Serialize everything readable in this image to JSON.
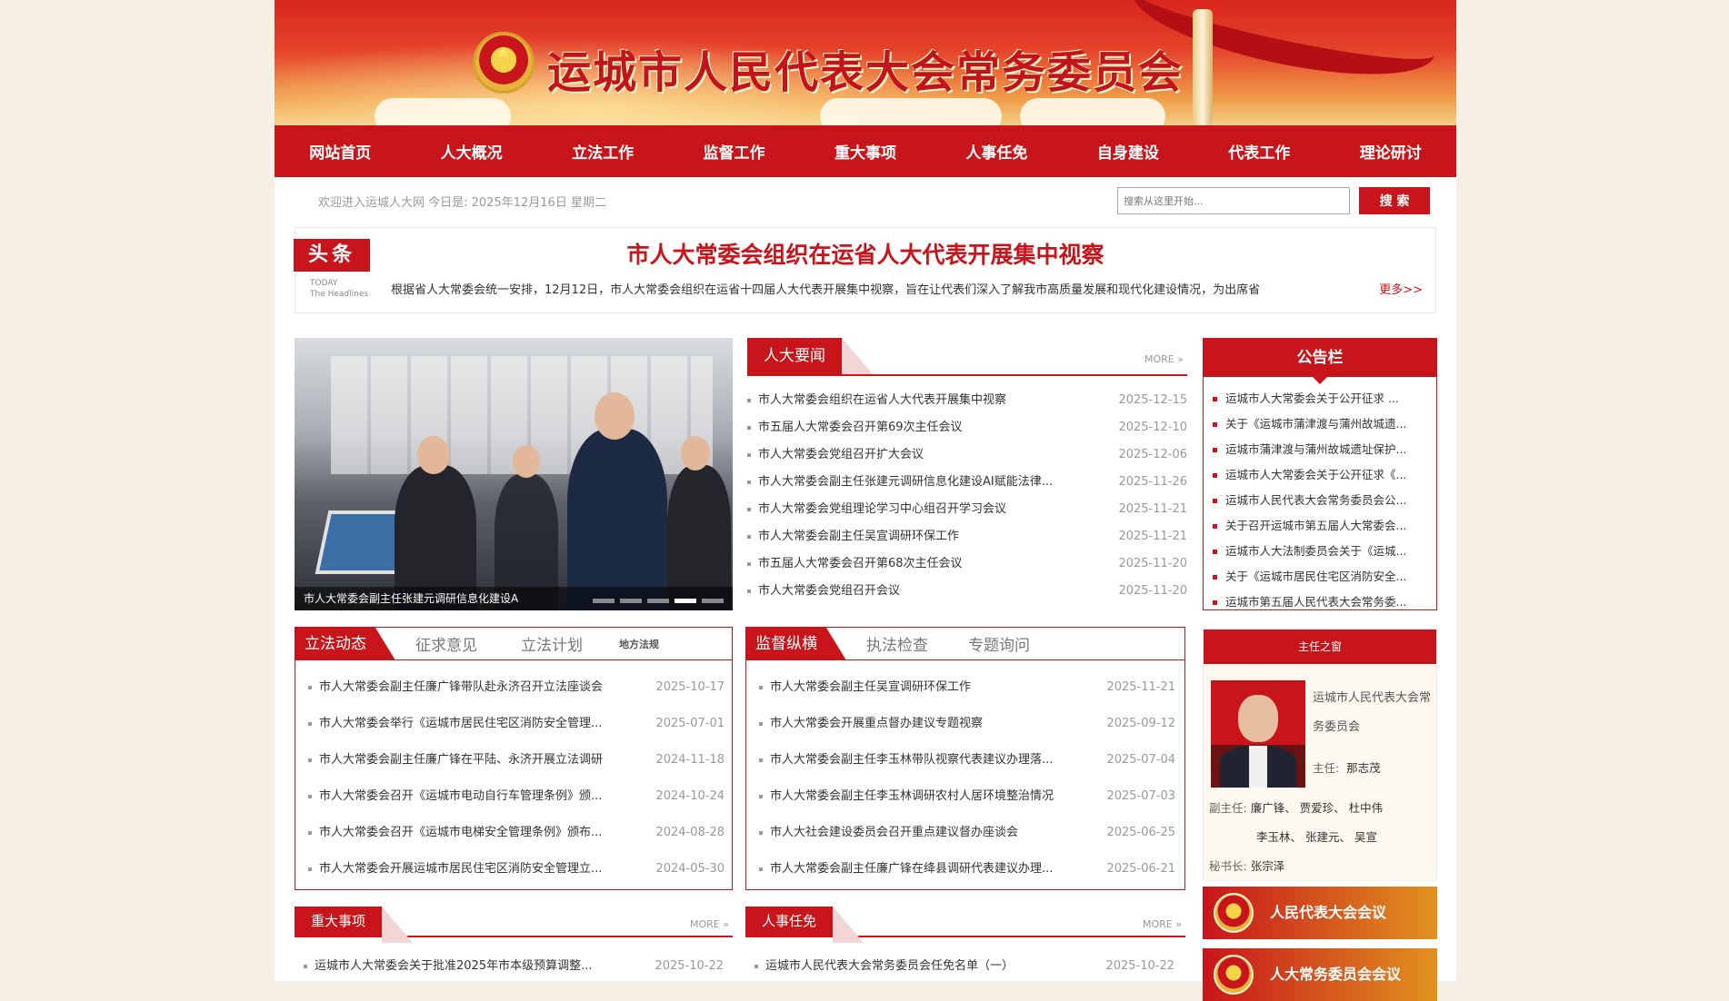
{
  "header": {
    "site_title": "运城市人民代表大会常务委员会"
  },
  "nav": [
    "网站首页",
    "人大概况",
    "立法工作",
    "监督工作",
    "重大事项",
    "人事任免",
    "自身建设",
    "代表工作",
    "理论研讨"
  ],
  "welcome_text": "欢迎进入运城人大网 今日是: 2025年12月16日 星期二",
  "search": {
    "placeholder": "搜索从这里开始...",
    "button": "搜 索"
  },
  "headline": {
    "badge": "头条",
    "sub1": "TODAY",
    "sub2": "The Headlines",
    "title": "市人大常委会组织在运省人大代表开展集中视察",
    "summary": "根据省人大常委会统一安排，12月12日，市人大常委会组织在运省十四届人大代表开展集中视察，旨在让代表们深入了解我市高质量发展和现代化建设情况，为出席省",
    "more": "更多>>"
  },
  "slideshow": {
    "caption": "市人大常委会副主任张建元调研信息化建设A"
  },
  "news": {
    "title": "人大要闻",
    "more": "MORE",
    "items": [
      {
        "title": "市人大常委会组织在运省人大代表开展集中视察",
        "date": "2025-12-15"
      },
      {
        "title": "市五届人大常委会召开第69次主任会议",
        "date": "2025-12-10"
      },
      {
        "title": "市人大常委会党组召开扩大会议",
        "date": "2025-12-06"
      },
      {
        "title": "市人大常委会副主任张建元调研信息化建设AI赋能法律...",
        "date": "2025-11-26"
      },
      {
        "title": "市人大常委会党组理论学习中心组召开学习会议",
        "date": "2025-11-21"
      },
      {
        "title": "市人大常委会副主任吴宣调研环保工作",
        "date": "2025-11-21"
      },
      {
        "title": "市五届人大常委会召开第68次主任会议",
        "date": "2025-11-20"
      },
      {
        "title": "市人大常委会党组召开会议",
        "date": "2025-11-20"
      }
    ]
  },
  "legislation": {
    "tabs": [
      "立法动态",
      "征求意见",
      "立法计划",
      "地方法规"
    ],
    "items": [
      {
        "title": "市人大常委会副主任廉广锋带队赴永济召开立法座谈会",
        "date": "2025-10-17"
      },
      {
        "title": "市人大常委会举行《运城市居民住宅区消防安全管理...",
        "date": "2025-07-01"
      },
      {
        "title": "市人大常委会副主任廉广锋在平陆、永济开展立法调研",
        "date": "2024-11-18"
      },
      {
        "title": "市人大常委会召开《运城市电动自行车管理条例》颁...",
        "date": "2024-10-24"
      },
      {
        "title": "市人大常委会召开《运城市电梯安全管理条例》颁布...",
        "date": "2024-08-28"
      },
      {
        "title": "市人大常委会开展运城市居民住宅区消防安全管理立...",
        "date": "2024-05-30"
      }
    ]
  },
  "supervision": {
    "tabs": [
      "监督纵横",
      "执法检查",
      "专题询问"
    ],
    "items": [
      {
        "title": "市人大常委会副主任吴宣调研环保工作",
        "date": "2025-11-21"
      },
      {
        "title": "市人大常委会开展重点督办建议专题视察",
        "date": "2025-09-12"
      },
      {
        "title": "市人大常委会副主任李玉林带队视察代表建议办理落...",
        "date": "2025-07-04"
      },
      {
        "title": "市人大常委会副主任李玉林调研农村人居环境整治情况",
        "date": "2025-07-03"
      },
      {
        "title": "市人大社会建设委员会召开重点建议督办座谈会",
        "date": "2025-06-25"
      },
      {
        "title": "市人大常委会副主任廉广锋在绛县调研代表建议办理...",
        "date": "2025-06-21"
      }
    ]
  },
  "major": {
    "title": "重大事项",
    "more": "MORE",
    "items": [
      {
        "title": "运城市人大常委会关于批准2025年市本级预算调整...",
        "date": "2025-10-22"
      }
    ]
  },
  "personnel": {
    "title": "人事任免",
    "more": "MORE",
    "items": [
      {
        "title": "运城市人民代表大会常务委员会任免名单（一）",
        "date": "2025-10-22"
      }
    ]
  },
  "notice": {
    "title": "公告栏",
    "items": [
      "运城市人大常委会关于公开征求 ...",
      "关于《运城市蒲津渡与蒲州故城遗...",
      "运城市蒲津渡与蒲州故城遗址保护...",
      "运城市人大常委会关于公开征求《...",
      "运城市人民代表大会常务委员会公...",
      "关于召开运城市第五届人大常委会...",
      "运城市人大法制委员会关于《运城...",
      "关于《运城市居民住宅区消防安全...",
      "运城市第五届人民代表大会常务委..."
    ]
  },
  "director": {
    "title": "主任之窗",
    "org": "运城市人民代表大会常务委员会",
    "chair_label": "主任:",
    "chair": "那志茂",
    "vice_label": "副主任:",
    "vice_line1": "廉广锋、 贾爱珍、 杜中伟",
    "vice_line2": "李玉林、 张建元、 吴宣",
    "sec_label": "秘书长:",
    "sec": "张宗泽"
  },
  "meetings": [
    "人民代表大会会议",
    "人大常务委员会会议"
  ],
  "colors": {
    "brand_red": "#c8151b",
    "background": "#f6efe4"
  }
}
